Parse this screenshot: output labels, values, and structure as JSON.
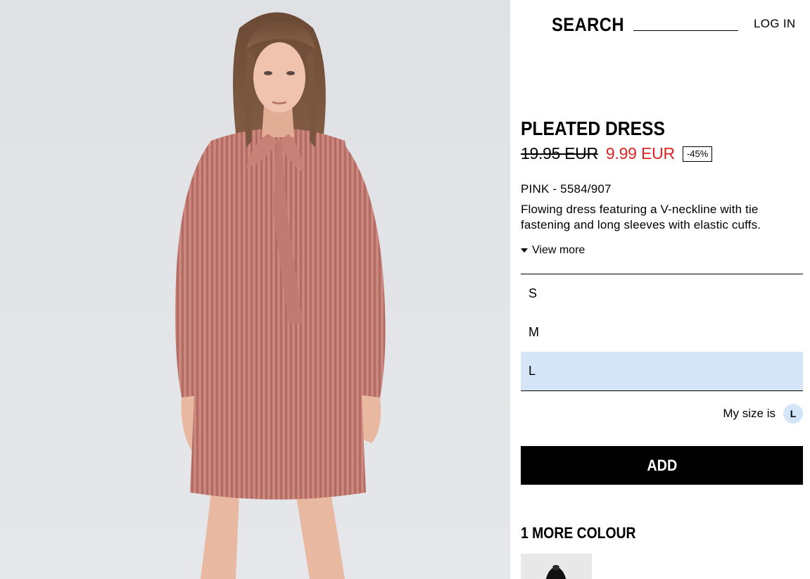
{
  "header": {
    "search_label": "SEARCH",
    "login_label": "LOG IN"
  },
  "product": {
    "title": "PLEATED DRESS",
    "price_old": "19.95 EUR",
    "price_new": "9.99 EUR",
    "discount": "-45%",
    "color_ref": "PINK - 5584/907",
    "description": "Flowing dress featuring a V-neckline with tie fastening and long sleeves with elastic cuffs.",
    "view_more": "View more",
    "sizes": [
      "S",
      "M",
      "L"
    ],
    "selected_size": "L",
    "my_size_label": "My size is",
    "my_size_value": "L",
    "add_label": "ADD",
    "more_colours": "1 MORE COLOUR"
  },
  "colors": {
    "price_sale": "#e02323",
    "size_selected_bg": "#d3e5f7",
    "dress": "#c47c72"
  },
  "icons": {
    "view_more": "triangle-down-icon"
  }
}
